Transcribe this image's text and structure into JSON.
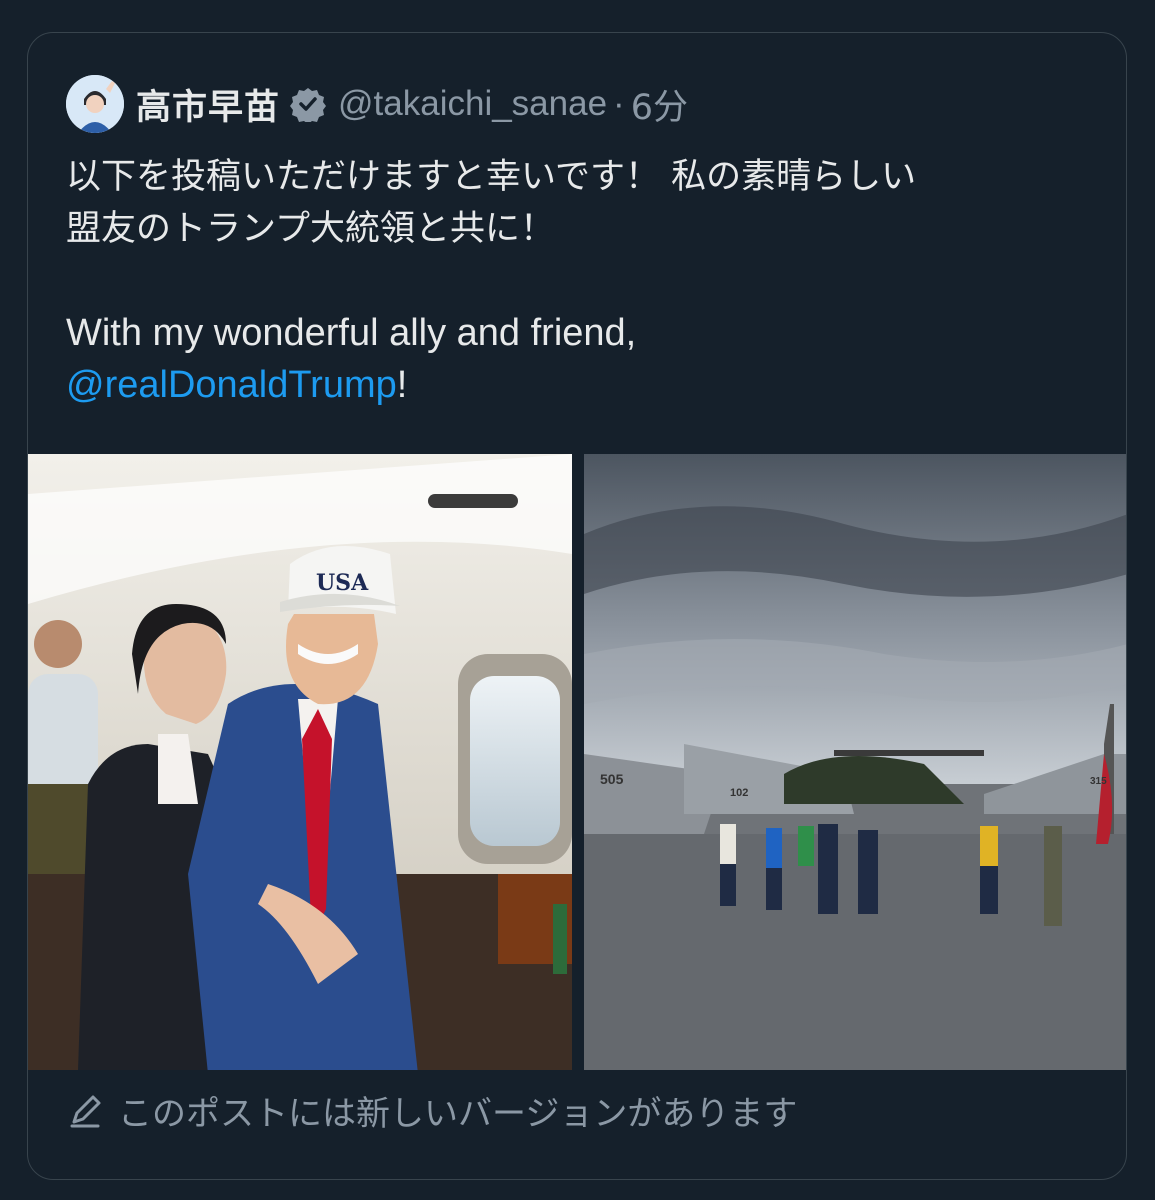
{
  "post": {
    "author": {
      "display_name": "高市早苗",
      "handle": "@takaichi_sanae",
      "verified_icon": "verified-badge-icon",
      "avatar": "avatar-photo"
    },
    "separator": "·",
    "timestamp": "6分",
    "text": {
      "ja_line1": "以下を投稿いただけますと幸いです！ 私の素晴らしい",
      "ja_line2": "盟友のトランプ大統領と共に！",
      "en_line1": "With my wonderful ally and friend,",
      "en_mention": "@realDonaldTrump",
      "en_suffix": "!"
    },
    "media": [
      {
        "name": "photo-helicopter-cabin",
        "cap_text": "USA"
      },
      {
        "name": "photo-carrier-deck",
        "aircraft_numbers": [
          "505",
          "102",
          "315"
        ]
      }
    ],
    "footer": {
      "icon": "pen-icon",
      "label": "このポストには新しいバージョンがあります"
    }
  },
  "colors": {
    "background": "#15202b",
    "border": "#38444d",
    "text": "#e7e9ea",
    "muted": "#8b98a5",
    "link": "#1d9bf0"
  }
}
